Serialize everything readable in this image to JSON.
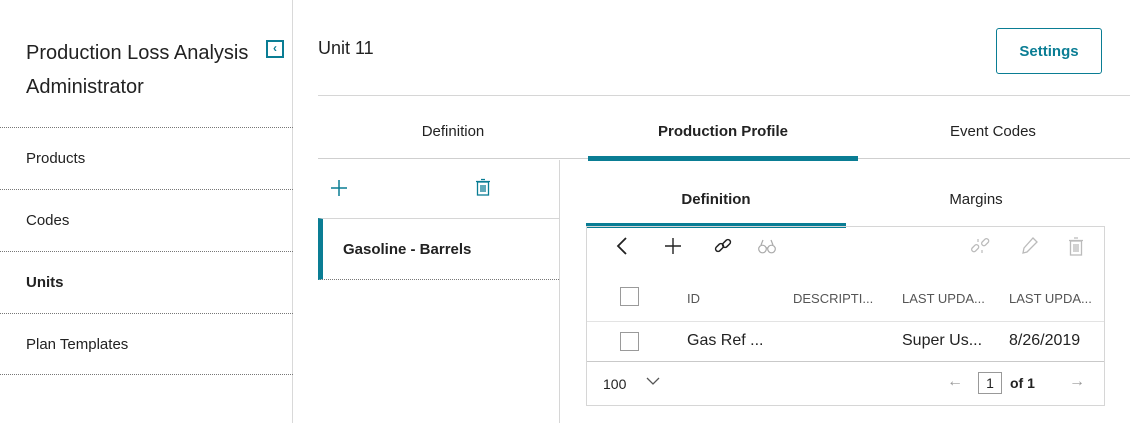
{
  "app": {
    "title": "Production Loss Analysis Administrator",
    "collapse_icon": "chevron-left-icon",
    "accent_color": "#0a7d94"
  },
  "sidebar": {
    "items": [
      {
        "label": "Products",
        "active": false
      },
      {
        "label": "Codes",
        "active": false
      },
      {
        "label": "Units",
        "active": true
      },
      {
        "label": "Plan Templates",
        "active": false
      }
    ]
  },
  "header": {
    "title": "Unit 11",
    "settings_label": "Settings"
  },
  "main_tabs": [
    {
      "label": "Definition",
      "active": false
    },
    {
      "label": "Production Profile",
      "active": true
    },
    {
      "label": "Event Codes",
      "active": false
    }
  ],
  "products": {
    "add_icon": "plus-icon",
    "delete_icon": "trash-icon",
    "items": [
      {
        "label": "Gasoline - Barrels",
        "selected": true
      }
    ]
  },
  "sub_tabs": [
    {
      "label": "Definition",
      "active": true
    },
    {
      "label": "Margins",
      "active": false
    }
  ],
  "grid": {
    "toolbar_icons": [
      "back-icon",
      "plus-icon",
      "link-icon",
      "binoculars-icon",
      "unlink-icon",
      "pencil-icon",
      "trash-icon"
    ],
    "columns": [
      "ID",
      "DESCRIPTI...",
      "LAST UPDA...",
      "LAST UPDA..."
    ],
    "rows": [
      {
        "id": "Gas Ref ...",
        "description": "",
        "last_updated_by": "Super Us...",
        "last_updated": "8/26/2019"
      }
    ],
    "page_size": "100",
    "current_page": "1",
    "page_total_label": "of 1"
  }
}
